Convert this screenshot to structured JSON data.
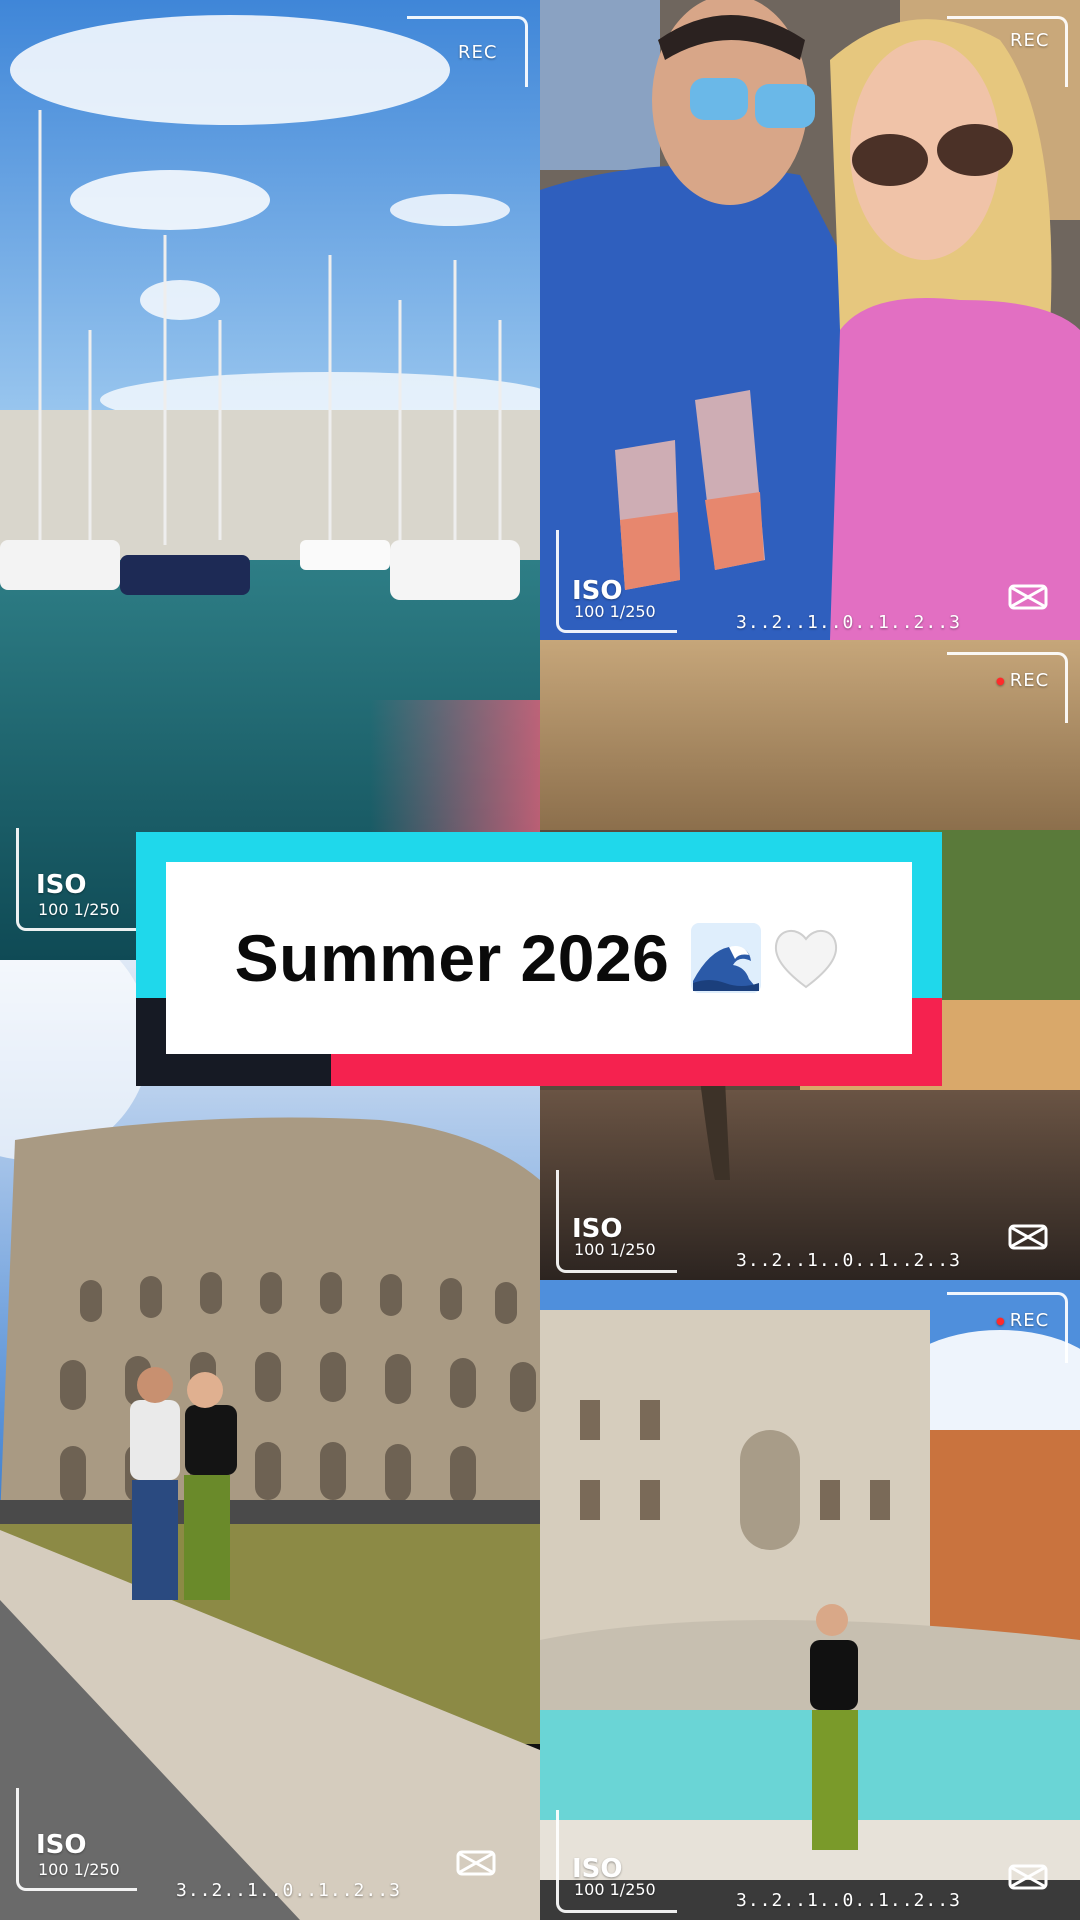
{
  "overlay": {
    "rec_label": "REC",
    "iso_title": "ISO",
    "iso_sub": "100 1/250",
    "scale": "3..2..1..0..1..2..3",
    "logo_icon": "capcut-logo-icon"
  },
  "title": {
    "text": "Summer 2026",
    "emoji_1": "wave-emoji",
    "emoji_2": "white-heart-emoji",
    "colors": {
      "cyan": "#1fd8eb",
      "pink": "#f5224f",
      "dark": "#161a24",
      "card": "#ffffff"
    }
  },
  "tiles": [
    {
      "id": "marina",
      "scene": "sailboats-marina"
    },
    {
      "id": "selfie",
      "scene": "couple-toasting-selfie"
    },
    {
      "id": "hallway",
      "scene": "hotel-hallway"
    },
    {
      "id": "colosseum",
      "scene": "couple-at-colosseum"
    },
    {
      "id": "trevi",
      "scene": "woman-at-trevi-fountain"
    }
  ]
}
